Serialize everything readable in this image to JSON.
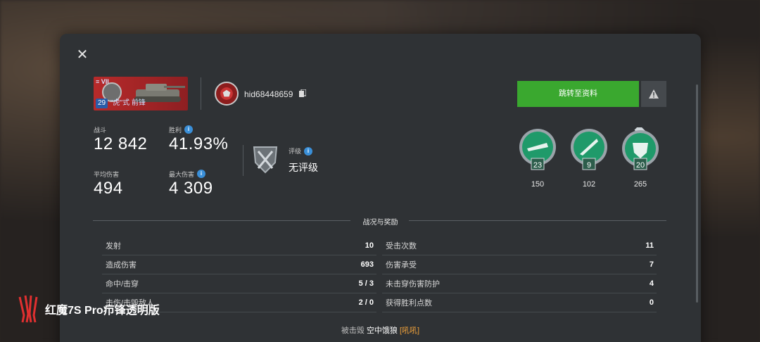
{
  "tank": {
    "tier_roman": "VII",
    "level": "29",
    "name": "\"虎\"式 前锋"
  },
  "player": {
    "name": "hid68448659"
  },
  "buttons": {
    "goto_profile": "跳转至资料"
  },
  "stats": {
    "battles": {
      "label": "战斗",
      "value": "12 842"
    },
    "win_rate": {
      "label": "胜利",
      "value": "41.93%"
    },
    "avg_damage": {
      "label": "平均伤害",
      "value": "494"
    },
    "max_damage": {
      "label": "最大伤害",
      "value": "4 309"
    }
  },
  "rating": {
    "label": "评级",
    "value": "无评级"
  },
  "medals": [
    {
      "level": "23",
      "count": "150",
      "icon": "cannon-medal-icon"
    },
    {
      "level": "9",
      "count": "102",
      "icon": "shell-medal-icon"
    },
    {
      "level": "20",
      "count": "265",
      "icon": "shield-medal-icon"
    }
  ],
  "section_title": "战况与奖励",
  "left_table": [
    {
      "k": "发射",
      "v": "10"
    },
    {
      "k": "造成伤害",
      "v": "693"
    },
    {
      "k": "命中/击穿",
      "v": "5 / 3"
    },
    {
      "k": "击伤/击毁敌人",
      "v": "2 / 0"
    }
  ],
  "right_table": [
    {
      "k": "受击次数",
      "v": "11"
    },
    {
      "k": "伤害承受",
      "v": "7"
    },
    {
      "k": "未击穿伤害防护",
      "v": "4"
    },
    {
      "k": "获得胜利点数",
      "v": "0"
    }
  ],
  "killed_by": {
    "label": "被击毁",
    "who": "空中饿狼",
    "clan": "[吼吼]"
  },
  "watermark": {
    "text": "红魔7S Pro疖锋透明版"
  },
  "colors": {
    "accent_green": "#3aa82f",
    "info_blue": "#3a8fd8",
    "clan_orange": "#e89d3a",
    "medal_green": "#1f9a6a"
  }
}
